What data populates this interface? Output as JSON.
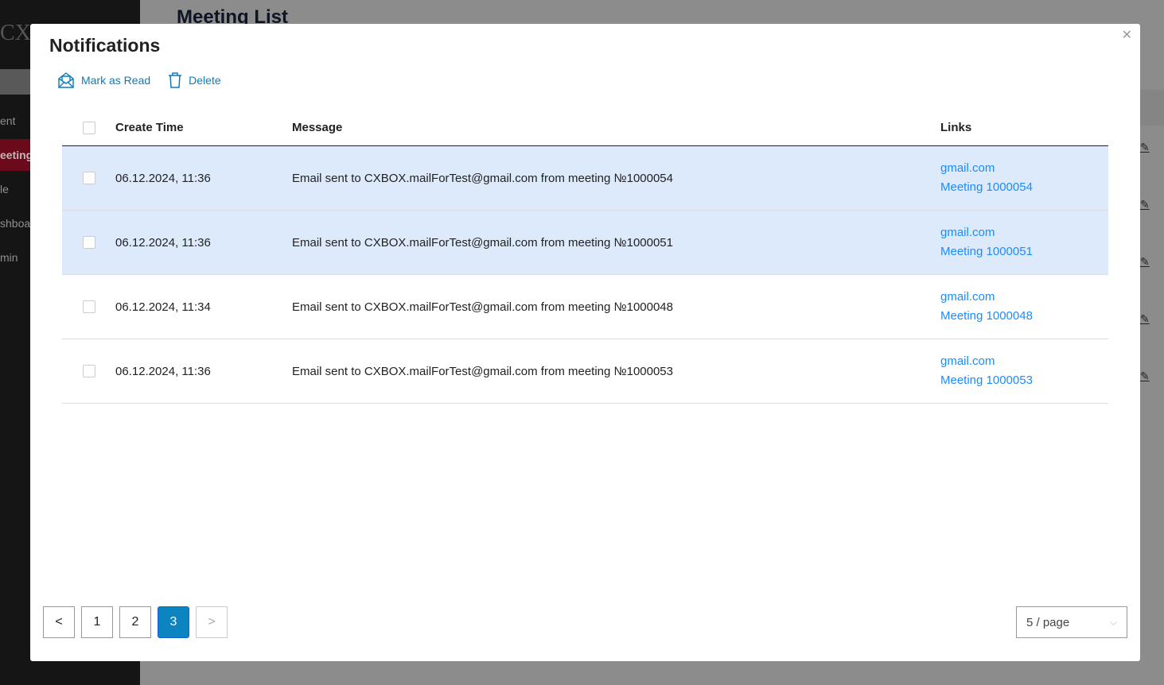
{
  "background": {
    "logo": "CX",
    "title": "Meeting List",
    "sidebar_items": [
      "ent",
      "eeting",
      "le",
      "shboa",
      "min"
    ],
    "active_index": 1,
    "edit_icon": "pencil-icon"
  },
  "modal": {
    "title": "Notifications",
    "close_icon": "close-icon",
    "actions": {
      "mark_read": "Mark as Read",
      "delete": "Delete"
    },
    "columns": [
      "Create Time",
      "Message",
      "Links"
    ],
    "rows": [
      {
        "time": "06.12.2024, 11:36",
        "message": "Email sent to CXBOX.mailForTest@gmail.com from meeting №1000054",
        "link1": "gmail.com",
        "link2": "Meeting 1000054",
        "selected": true
      },
      {
        "time": "06.12.2024, 11:36",
        "message": "Email sent to CXBOX.mailForTest@gmail.com from meeting №1000051",
        "link1": "gmail.com",
        "link2": "Meeting 1000051",
        "selected": true
      },
      {
        "time": "06.12.2024, 11:34",
        "message": "Email sent to CXBOX.mailForTest@gmail.com from meeting №1000048",
        "link1": "gmail.com",
        "link2": "Meeting 1000048",
        "selected": false
      },
      {
        "time": "06.12.2024, 11:36",
        "message": "Email sent to CXBOX.mailForTest@gmail.com from meeting №1000053",
        "link1": "gmail.com",
        "link2": "Meeting 1000053",
        "selected": false
      }
    ],
    "pagination": {
      "prev": "<",
      "pages": [
        "1",
        "2",
        "3"
      ],
      "current": "3",
      "next": ">",
      "page_size": "5 / page"
    },
    "colors": {
      "accent": "#0b84c0",
      "link": "#1a8cff",
      "selected_row": "#dceafb"
    }
  }
}
